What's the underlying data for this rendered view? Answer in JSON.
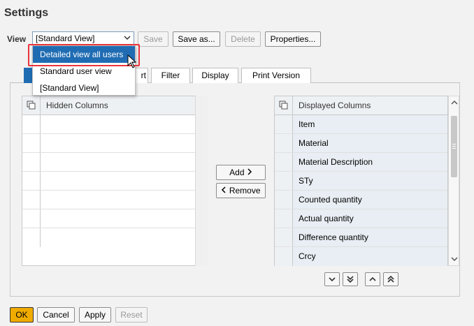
{
  "window": {
    "title": "Settings"
  },
  "view": {
    "label": "View",
    "selected": "[Standard View]",
    "dropdown_options": [
      "Detailed view all users",
      "Standard user view",
      "[Standard View]"
    ]
  },
  "toolbar": {
    "save": "Save",
    "save_as": "Save as...",
    "delete": "Delete",
    "properties": "Properties..."
  },
  "tabs": [
    {
      "label": ""
    },
    {
      "label": "rt"
    },
    {
      "label": "Filter"
    },
    {
      "label": "Display"
    },
    {
      "label": "Print Version"
    }
  ],
  "hidden_columns": {
    "header": "Hidden Columns",
    "rows": []
  },
  "move_buttons": {
    "add": "Add",
    "remove": "Remove"
  },
  "displayed_columns": {
    "header": "Displayed Columns",
    "rows": [
      "Item",
      "Material",
      "Material Description",
      "STy",
      "Counted quantity",
      "Actual quantity",
      "Difference quantity",
      "Crcy"
    ]
  },
  "footer": {
    "ok": "OK",
    "cancel": "Cancel",
    "apply": "Apply",
    "reset": "Reset"
  },
  "colors": {
    "accent": "#1f6cb3",
    "ok_button": "#f0ab00",
    "highlight_border": "#e8353b"
  }
}
